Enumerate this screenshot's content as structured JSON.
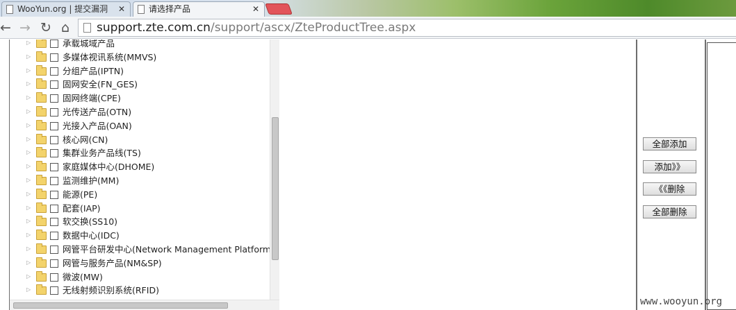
{
  "browser": {
    "tabs": [
      {
        "title": "WooYun.org | 提交漏洞",
        "close": "✕"
      },
      {
        "title": "请选择产品",
        "close": "✕"
      }
    ],
    "url": {
      "host": "support.zte.com.cn",
      "path": "/support/ascx/ZteProductTree.aspx"
    }
  },
  "tree": {
    "nodes": [
      {
        "label": "承载城域产品"
      },
      {
        "label": "多媒体视讯系统(MMVS)"
      },
      {
        "label": "分组产品(IPTN)"
      },
      {
        "label": "固网安全(FN_GES)"
      },
      {
        "label": "固网终端(CPE)"
      },
      {
        "label": "光传送产品(OTN)"
      },
      {
        "label": "光接入产品(OAN)"
      },
      {
        "label": "核心网(CN)"
      },
      {
        "label": "集群业务产品线(TS)"
      },
      {
        "label": "家庭媒体中心(DHOME)"
      },
      {
        "label": "监测维护(MM)"
      },
      {
        "label": "能源(PE)"
      },
      {
        "label": "配套(IAP)"
      },
      {
        "label": "软交换(SS10)"
      },
      {
        "label": "数据中心(IDC)"
      },
      {
        "label": "网管平台研发中心(Network Management Platform R"
      },
      {
        "label": "网管与服务产品(NM&SP)"
      },
      {
        "label": "微波(MW)"
      },
      {
        "label": "无线射频识别系统(RFID)"
      }
    ]
  },
  "actions": {
    "add_all": "全部添加",
    "add": "添加》》",
    "remove": "《《删除",
    "remove_all": "全部删除"
  },
  "watermark": "www.wooyun.org"
}
